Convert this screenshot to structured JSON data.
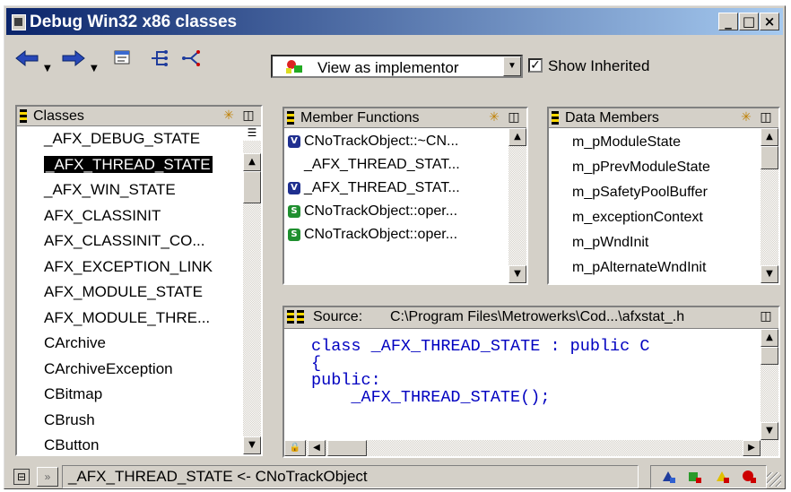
{
  "window": {
    "title": "Debug Win32 x86 classes",
    "caption_buttons": [
      "_",
      "□",
      "×"
    ]
  },
  "toolbar": {
    "back_icon": "back-arrow-icon",
    "forward_icon": "forward-arrow-icon",
    "view_combo_value": "View as implementor",
    "show_inherited_label": "Show Inherited",
    "show_inherited_checked": true
  },
  "classes_pane": {
    "header": "Classes",
    "items": [
      "_AFX_DEBUG_STATE",
      "_AFX_THREAD_STATE",
      "_AFX_WIN_STATE",
      "AFX_CLASSINIT",
      "AFX_CLASSINIT_CO...",
      "AFX_EXCEPTION_LINK",
      "AFX_MODULE_STATE",
      "AFX_MODULE_THRE...",
      "CArchive",
      "CArchiveException",
      "CBitmap",
      "CBrush",
      "CButton"
    ],
    "selected_index": 1
  },
  "member_functions_pane": {
    "header": "Member Functions",
    "items": [
      {
        "badge": "V",
        "badge_color": "#1f2f8f",
        "label": "CNoTrackObject::~CN..."
      },
      {
        "badge": "",
        "badge_color": "",
        "label": "_AFX_THREAD_STAT..."
      },
      {
        "badge": "V",
        "badge_color": "#1f2f8f",
        "label": "_AFX_THREAD_STAT..."
      },
      {
        "badge": "S",
        "badge_color": "#1f8f2f",
        "label": "CNoTrackObject::oper..."
      },
      {
        "badge": "S",
        "badge_color": "#1f8f2f",
        "label": "CNoTrackObject::oper..."
      }
    ]
  },
  "data_members_pane": {
    "header": "Data Members",
    "items": [
      "m_pModuleState",
      "m_pPrevModuleState",
      "m_pSafetyPoolBuffer",
      "m_exceptionContext",
      "m_pWndInit",
      "m_pAlternateWndInit"
    ]
  },
  "source_pane": {
    "label": "Source:",
    "path": "C:\\Program Files\\Metrowerks\\Cod...\\afxstat_.h",
    "code_lines": [
      "class _AFX_THREAD_STATE : public C",
      "{",
      "public:",
      "    _AFX_THREAD_STATE();"
    ]
  },
  "statusbar": {
    "text": "_AFX_THREAD_STATE <- CNoTrackObject"
  },
  "colors": {
    "title_gradient_start": "#0a246a",
    "title_gradient_end": "#a6caf0",
    "face": "#d4d0c8",
    "code": "#0000c0"
  }
}
